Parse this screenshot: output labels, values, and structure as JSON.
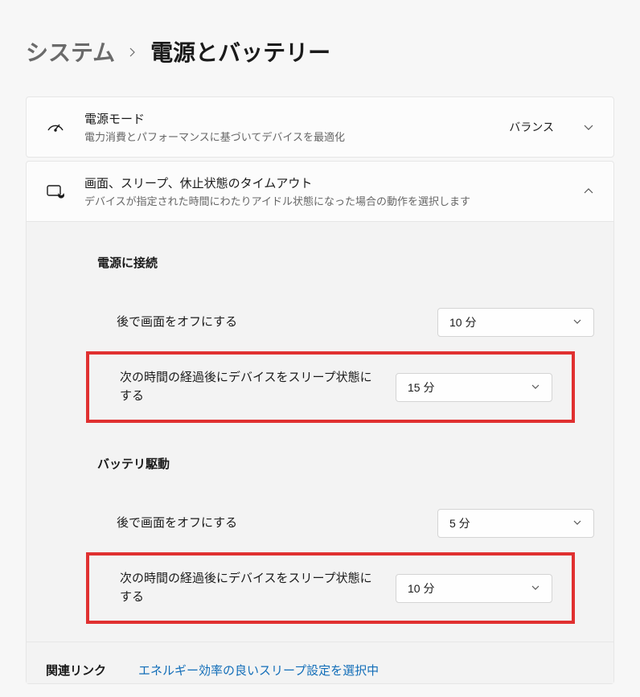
{
  "breadcrumb": {
    "parent": "システム",
    "current": "電源とバッテリー"
  },
  "powerMode": {
    "title": "電源モード",
    "subtitle": "電力消費とパフォーマンスに基づいてデバイスを最適化",
    "value": "バランス"
  },
  "timeouts": {
    "title": "画面、スリープ、休止状態のタイムアウト",
    "subtitle": "デバイスが指定された時間にわたりアイドル状態になった場合の動作を選択します",
    "pluggedIn": {
      "heading": "電源に接続",
      "screenOff": {
        "label": "後で画面をオフにする",
        "value": "10 分"
      },
      "sleep": {
        "label": "次の時間の経過後にデバイスをスリープ状態にする",
        "value": "15 分"
      }
    },
    "onBattery": {
      "heading": "バッテリ駆動",
      "screenOff": {
        "label": "後で画面をオフにする",
        "value": "5 分"
      },
      "sleep": {
        "label": "次の時間の経過後にデバイスをスリープ状態にする",
        "value": "10 分"
      }
    }
  },
  "related": {
    "title": "関連リンク",
    "link": "エネルギー効率の良いスリープ設定を選択中"
  }
}
